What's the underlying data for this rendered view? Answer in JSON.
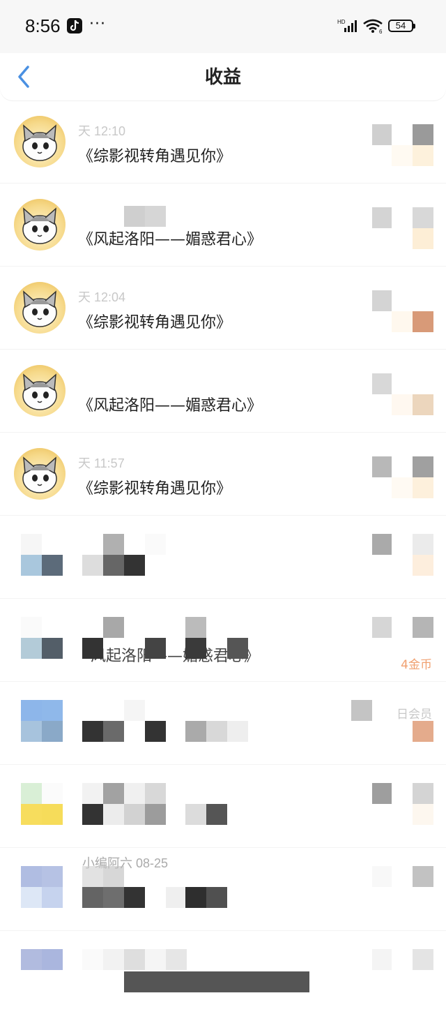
{
  "status_bar": {
    "time": "8:56",
    "more": "···",
    "battery": "54"
  },
  "header": {
    "title": "收益"
  },
  "items": [
    {
      "meta": "天 12:10",
      "title": "《综影视转角遇见你》"
    },
    {
      "meta": "",
      "title": "《风起洛阳——媚惑君心》"
    },
    {
      "meta": "天 12:04",
      "title": "《综影视转角遇见你》"
    },
    {
      "meta": "",
      "title": "《风起洛阳——媚惑君心》"
    },
    {
      "meta": "天 11:57",
      "title": "《综影视转角遇见你》"
    }
  ],
  "blurred_items": [
    {
      "text": ""
    },
    {
      "text": "风起洛阳——媚惑君心》",
      "reward": "4金币"
    },
    {
      "text": "",
      "reward": "日会员"
    },
    {
      "text": ""
    },
    {
      "meta": "小编阿六 08-25"
    },
    {
      "text": ""
    }
  ],
  "colors": {
    "accent_blue": "#4a90e2",
    "reward_orange": "#f0a070"
  }
}
